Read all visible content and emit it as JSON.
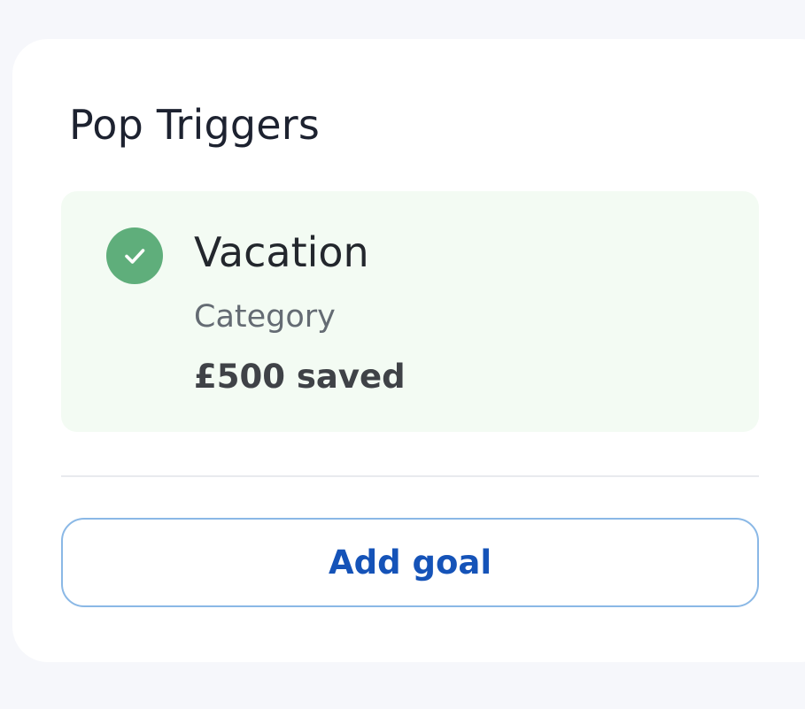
{
  "card": {
    "title": "Pop Triggers"
  },
  "goal": {
    "status_icon": "check-icon",
    "name": "Vacation",
    "category": "Category",
    "amount": "£500 saved"
  },
  "actions": {
    "add_goal_label": "Add goal"
  },
  "colors": {
    "background": "#f6f7fb",
    "card": "#ffffff",
    "goal_tile": "#f3fbf3",
    "success": "#5fae7b",
    "accent": "#1553b8",
    "button_border": "#8ab8e6"
  }
}
